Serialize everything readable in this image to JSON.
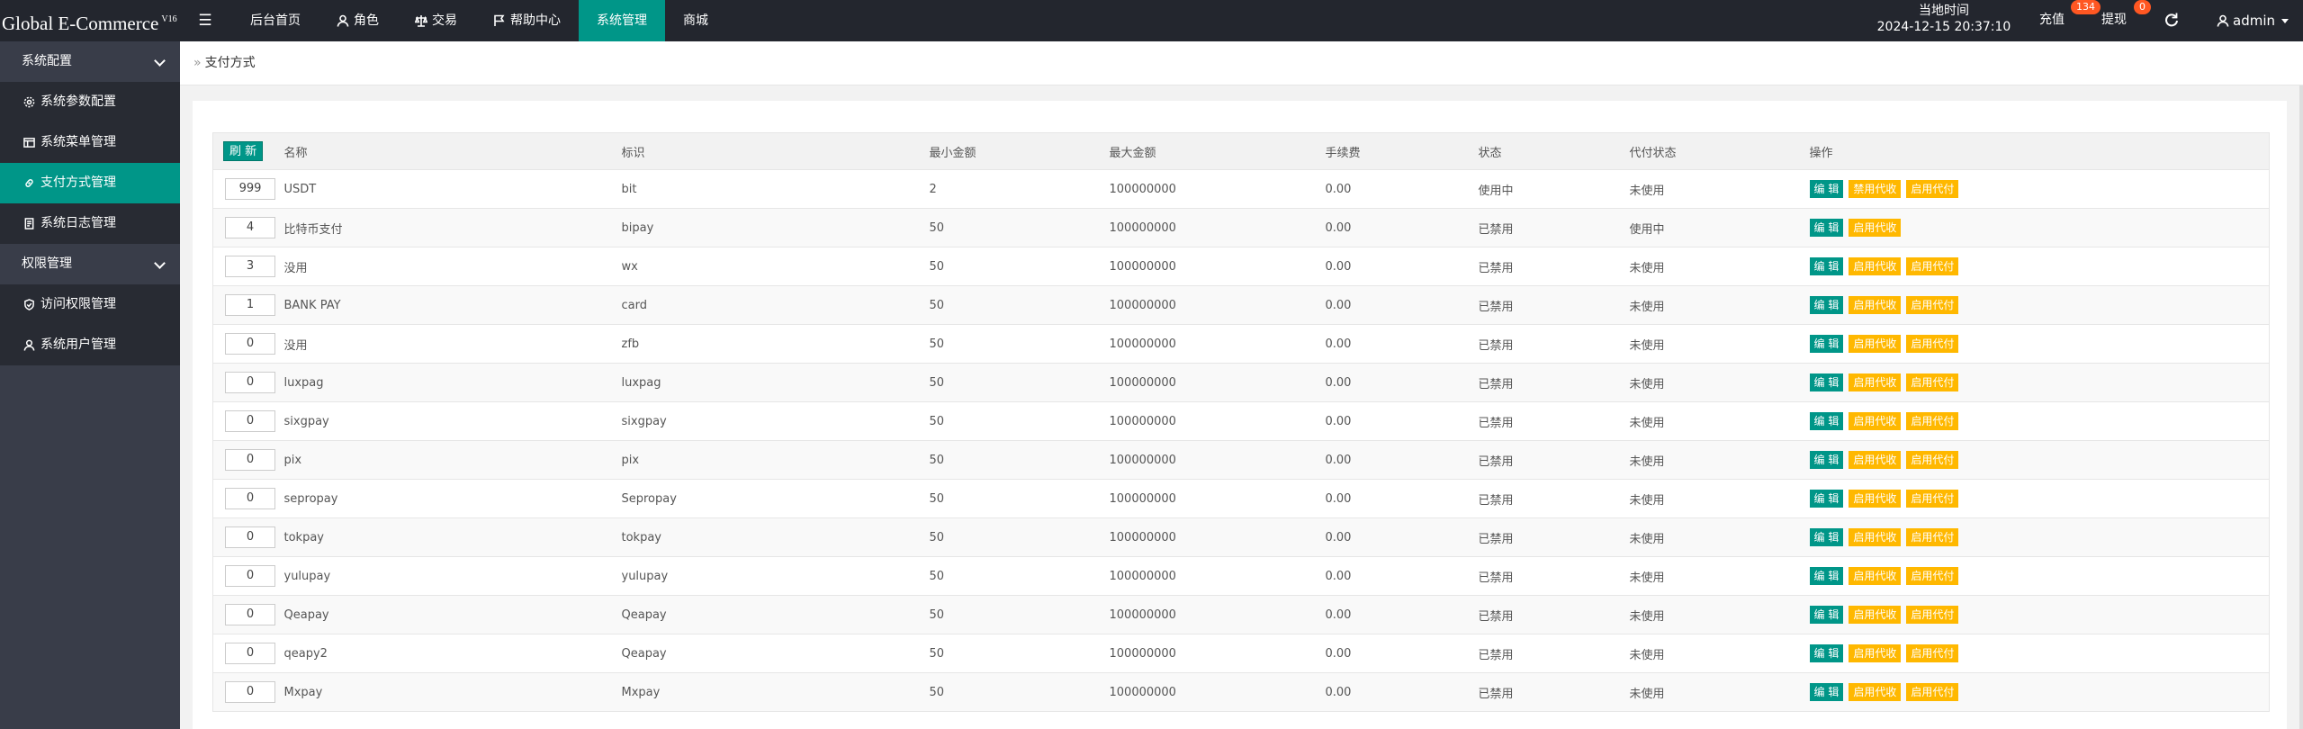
{
  "header": {
    "logo": "Global E-Commerce",
    "version": "V16",
    "nav": [
      "后台首页",
      "角色",
      "交易",
      "帮助中心",
      "系统管理",
      "商城"
    ],
    "time_label": "当地时间",
    "time_value": "2024-12-15 20:37:10",
    "recharge_label": "充值",
    "recharge_badge": "134",
    "withdraw_label": "提现",
    "withdraw_badge": "0",
    "user": "admin"
  },
  "sidebar": {
    "group1": "系统配置",
    "items1": [
      "系统参数配置",
      "系统菜单管理",
      "支付方式管理",
      "系统日志管理"
    ],
    "group2": "权限管理",
    "items2": [
      "访问权限管理",
      "系统用户管理"
    ]
  },
  "breadcrumb": "支付方式",
  "table": {
    "refresh_label": "刷 新",
    "columns": [
      "名称",
      "标识",
      "最小金额",
      "最大金额",
      "手续费",
      "状态",
      "代付状态",
      "操作"
    ],
    "edit_label": "编 辑",
    "rows": [
      {
        "sort": "999",
        "name": "USDT",
        "code": "bit",
        "min": "2",
        "max": "100000000",
        "fee": "0.00",
        "status": "使用中",
        "payout": "未使用",
        "actions": [
          "编 辑",
          "禁用代收",
          "启用代付"
        ]
      },
      {
        "sort": "4",
        "name": "比特币支付",
        "code": "bipay",
        "min": "50",
        "max": "100000000",
        "fee": "0.00",
        "status": "已禁用",
        "payout": "使用中",
        "actions": [
          "编 辑",
          "启用代收"
        ]
      },
      {
        "sort": "3",
        "name": "没用",
        "code": "wx",
        "min": "50",
        "max": "100000000",
        "fee": "0.00",
        "status": "已禁用",
        "payout": "未使用",
        "actions": [
          "编 辑",
          "启用代收",
          "启用代付"
        ]
      },
      {
        "sort": "1",
        "name": "BANK PAY",
        "code": "card",
        "min": "50",
        "max": "100000000",
        "fee": "0.00",
        "status": "已禁用",
        "payout": "未使用",
        "actions": [
          "编 辑",
          "启用代收",
          "启用代付"
        ]
      },
      {
        "sort": "0",
        "name": "没用",
        "code": "zfb",
        "min": "50",
        "max": "100000000",
        "fee": "0.00",
        "status": "已禁用",
        "payout": "未使用",
        "actions": [
          "编 辑",
          "启用代收",
          "启用代付"
        ]
      },
      {
        "sort": "0",
        "name": "luxpag",
        "code": "luxpag",
        "min": "50",
        "max": "100000000",
        "fee": "0.00",
        "status": "已禁用",
        "payout": "未使用",
        "actions": [
          "编 辑",
          "启用代收",
          "启用代付"
        ]
      },
      {
        "sort": "0",
        "name": "sixgpay",
        "code": "sixgpay",
        "min": "50",
        "max": "100000000",
        "fee": "0.00",
        "status": "已禁用",
        "payout": "未使用",
        "actions": [
          "编 辑",
          "启用代收",
          "启用代付"
        ]
      },
      {
        "sort": "0",
        "name": "pix",
        "code": "pix",
        "min": "50",
        "max": "100000000",
        "fee": "0.00",
        "status": "已禁用",
        "payout": "未使用",
        "actions": [
          "编 辑",
          "启用代收",
          "启用代付"
        ]
      },
      {
        "sort": "0",
        "name": "sepropay",
        "code": "Sepropay",
        "min": "50",
        "max": "100000000",
        "fee": "0.00",
        "status": "已禁用",
        "payout": "未使用",
        "actions": [
          "编 辑",
          "启用代收",
          "启用代付"
        ]
      },
      {
        "sort": "0",
        "name": "tokpay",
        "code": "tokpay",
        "min": "50",
        "max": "100000000",
        "fee": "0.00",
        "status": "已禁用",
        "payout": "未使用",
        "actions": [
          "编 辑",
          "启用代收",
          "启用代付"
        ]
      },
      {
        "sort": "0",
        "name": "yulupay",
        "code": "yulupay",
        "min": "50",
        "max": "100000000",
        "fee": "0.00",
        "status": "已禁用",
        "payout": "未使用",
        "actions": [
          "编 辑",
          "启用代收",
          "启用代付"
        ]
      },
      {
        "sort": "0",
        "name": "Qeapay",
        "code": "Qeapay",
        "min": "50",
        "max": "100000000",
        "fee": "0.00",
        "status": "已禁用",
        "payout": "未使用",
        "actions": [
          "编 辑",
          "启用代收",
          "启用代付"
        ]
      },
      {
        "sort": "0",
        "name": "qeapy2",
        "code": "Qeapay",
        "min": "50",
        "max": "100000000",
        "fee": "0.00",
        "status": "已禁用",
        "payout": "未使用",
        "actions": [
          "编 辑",
          "启用代收",
          "启用代付"
        ]
      },
      {
        "sort": "0",
        "name": "Mxpay",
        "code": "Mxpay",
        "min": "50",
        "max": "100000000",
        "fee": "0.00",
        "status": "已禁用",
        "payout": "未使用",
        "actions": [
          "编 辑",
          "启用代收",
          "启用代付"
        ]
      }
    ]
  },
  "colors": {
    "accent": "#009688",
    "warning": "#ffb800",
    "danger": "#ff5722",
    "success": "#5fb878",
    "topbar": "#23262e",
    "sidebar": "#393d49"
  }
}
